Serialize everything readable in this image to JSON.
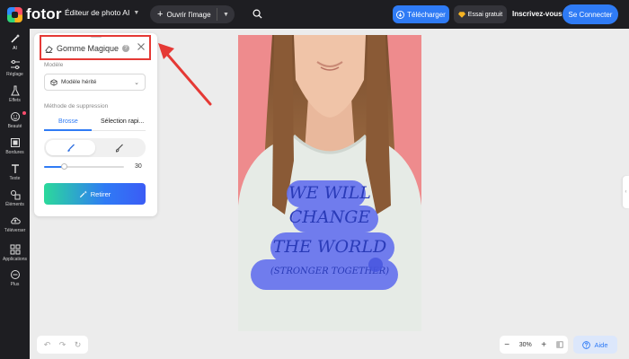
{
  "app": {
    "logo_text": "fotor",
    "editor_label": "Éditeur de photo AI",
    "open_label": "Ouvrir l'image",
    "download_label": "Télécharger",
    "trial_label": "Essai gratuit",
    "signup_label": "Inscrivez-vous",
    "login_label": "Se Connecter",
    "accent_color": "#2f7bf5"
  },
  "sidebar": {
    "items": [
      {
        "label": "AI",
        "icon": "magic-wand-icon"
      },
      {
        "label": "Réglage",
        "icon": "sliders-icon"
      },
      {
        "label": "Effets",
        "icon": "flask-icon"
      },
      {
        "label": "Beauté",
        "icon": "face-icon"
      },
      {
        "label": "Bordures",
        "icon": "frame-icon"
      },
      {
        "label": "Texte",
        "icon": "text-icon"
      },
      {
        "label": "Éléments",
        "icon": "shapes-icon"
      },
      {
        "label": "Téléverser",
        "icon": "upload-cloud-icon"
      },
      {
        "label": "Applications",
        "icon": "apps-icon"
      },
      {
        "label": "Plus",
        "icon": "more-icon"
      }
    ]
  },
  "panel": {
    "title": "Gomme Magique",
    "model_label": "Modèle",
    "model_value": "Modèle hérité",
    "method_label": "Méthode de suppression",
    "tabs": [
      "Brosse",
      "Sélection rapi..."
    ],
    "brush_size": "30",
    "brush_size_fraction": 0.25,
    "remove_label": "Retirer"
  },
  "canvas": {
    "shirt_text": [
      "WE WILL",
      "CHANGE",
      "THE WORLD",
      "(STRONGER TOGETHER)"
    ]
  },
  "bottom": {
    "zoom": "30%",
    "help_label": "Aide"
  }
}
